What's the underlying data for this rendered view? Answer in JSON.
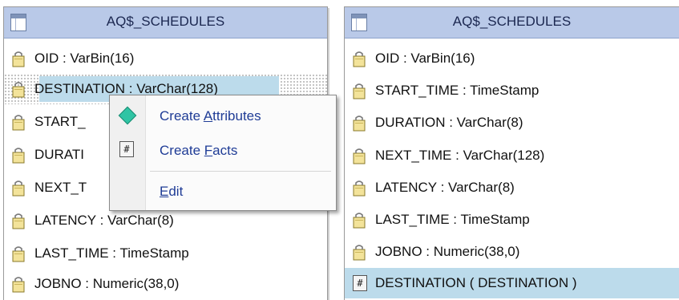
{
  "left_table": {
    "title": "AQ$_SCHEDULES",
    "rows": [
      {
        "label": "OID : VarBin(16)"
      },
      {
        "label": "DESTINATION : VarChar(128)"
      },
      {
        "label": "START_"
      },
      {
        "label": "DURATI"
      },
      {
        "label": "NEXT_T"
      },
      {
        "label": "LATENCY : VarChar(8)"
      },
      {
        "label": "LAST_TIME : TimeStamp"
      },
      {
        "label": "JOBNO : Numeric(38,0)"
      }
    ]
  },
  "right_table": {
    "title": "AQ$_SCHEDULES",
    "rows": [
      {
        "label": "OID : VarBin(16)"
      },
      {
        "label": "START_TIME : TimeStamp"
      },
      {
        "label": "DURATION : VarChar(8)"
      },
      {
        "label": "NEXT_TIME : VarChar(128)"
      },
      {
        "label": "LATENCY : VarChar(8)"
      },
      {
        "label": "LAST_TIME : TimeStamp"
      },
      {
        "label": "JOBNO : Numeric(38,0)"
      },
      {
        "label": "DESTINATION ( DESTINATION )"
      }
    ]
  },
  "context_menu": {
    "items": [
      {
        "pre": "Create ",
        "accel": "A",
        "post": "ttributes"
      },
      {
        "pre": "Create ",
        "accel": "F",
        "post": "acts"
      },
      {
        "pre": "",
        "accel": "E",
        "post": "dit"
      }
    ]
  },
  "icons": {
    "fact_glyph": "#"
  }
}
